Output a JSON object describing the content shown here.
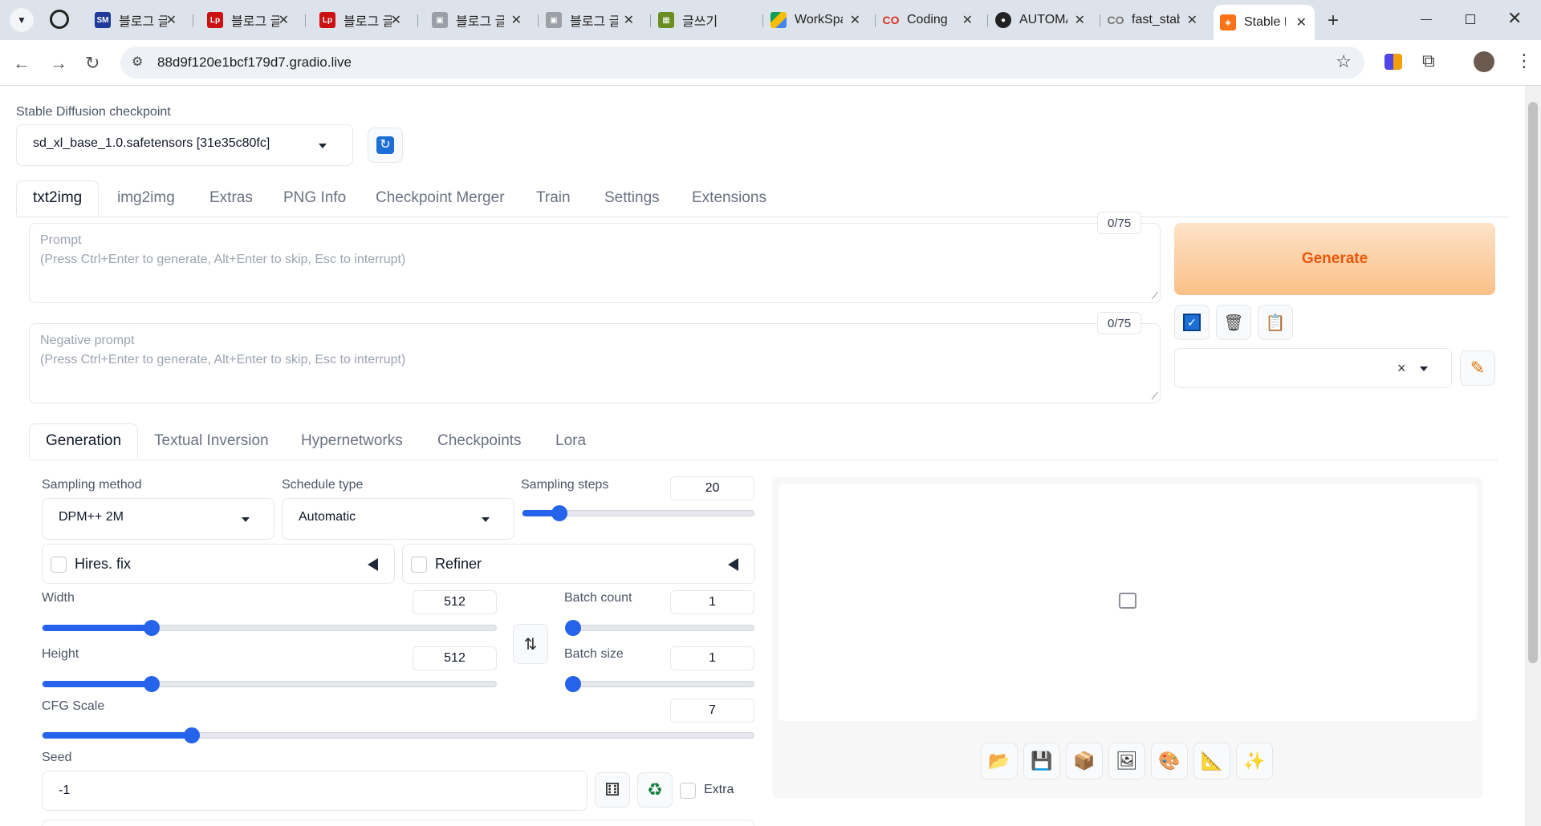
{
  "browser": {
    "tabs": [
      {
        "title": "블로그 글",
        "icon": "sm-favicon"
      },
      {
        "title": "블로그 글",
        "icon": "lp-favicon"
      },
      {
        "title": "블로그 글",
        "icon": "lp-favicon"
      },
      {
        "title": "블로그 글",
        "icon": "image-favicon"
      },
      {
        "title": "블로그 글",
        "icon": "image-favicon"
      },
      {
        "title": "글쓰기",
        "icon": "pixel-favicon"
      },
      {
        "title": "WorkSpace",
        "icon": "drive-favicon"
      },
      {
        "title": "Coding",
        "icon": "colab-favicon"
      },
      {
        "title": "AUTOMATIC",
        "icon": "github-favicon"
      },
      {
        "title": "fast_stable",
        "icon": "colab-favicon"
      },
      {
        "title": "Stable Diffusion",
        "icon": "gradio-favicon"
      }
    ],
    "url": "88d9f120e1bcf179d7.gradio.live"
  },
  "checkpoint": {
    "label": "Stable Diffusion checkpoint",
    "value": "sd_xl_base_1.0.safetensors [31e35c80fc]"
  },
  "main_tabs": [
    "txt2img",
    "img2img",
    "Extras",
    "PNG Info",
    "Checkpoint Merger",
    "Train",
    "Settings",
    "Extensions"
  ],
  "prompt": {
    "label": "Prompt",
    "hint": "(Press Ctrl+Enter to generate, Alt+Enter to skip, Esc to interrupt)",
    "counter": "0/75"
  },
  "negative_prompt": {
    "label": "Negative prompt",
    "hint": "(Press Ctrl+Enter to generate, Alt+Enter to skip, Esc to interrupt)",
    "counter": "0/75"
  },
  "generate": {
    "label": "Generate"
  },
  "style_select": {
    "clear": "×"
  },
  "sub_tabs": [
    "Generation",
    "Textual Inversion",
    "Hypernetworks",
    "Checkpoints",
    "Lora"
  ],
  "sampling_method": {
    "label": "Sampling method",
    "value": "DPM++ 2M"
  },
  "schedule_type": {
    "label": "Schedule type",
    "value": "Automatic"
  },
  "sampling_steps": {
    "label": "Sampling steps",
    "value": "20",
    "fraction": 0.16
  },
  "hires_fix": {
    "label": "Hires. fix",
    "checked": false
  },
  "refiner": {
    "label": "Refiner",
    "checked": false
  },
  "width": {
    "label": "Width",
    "value": "512",
    "fraction": 0.24
  },
  "height": {
    "label": "Height",
    "value": "512",
    "fraction": 0.24
  },
  "batch_count": {
    "label": "Batch count",
    "value": "1",
    "fraction": 0.0
  },
  "batch_size": {
    "label": "Batch size",
    "value": "1",
    "fraction": 0.0
  },
  "cfg_scale": {
    "label": "CFG Scale",
    "value": "7",
    "fraction": 0.21
  },
  "seed": {
    "label": "Seed",
    "value": "-1",
    "extra_label": "Extra"
  },
  "colors": {
    "accent": "#2563eb",
    "generate_text": "#ea580c"
  }
}
